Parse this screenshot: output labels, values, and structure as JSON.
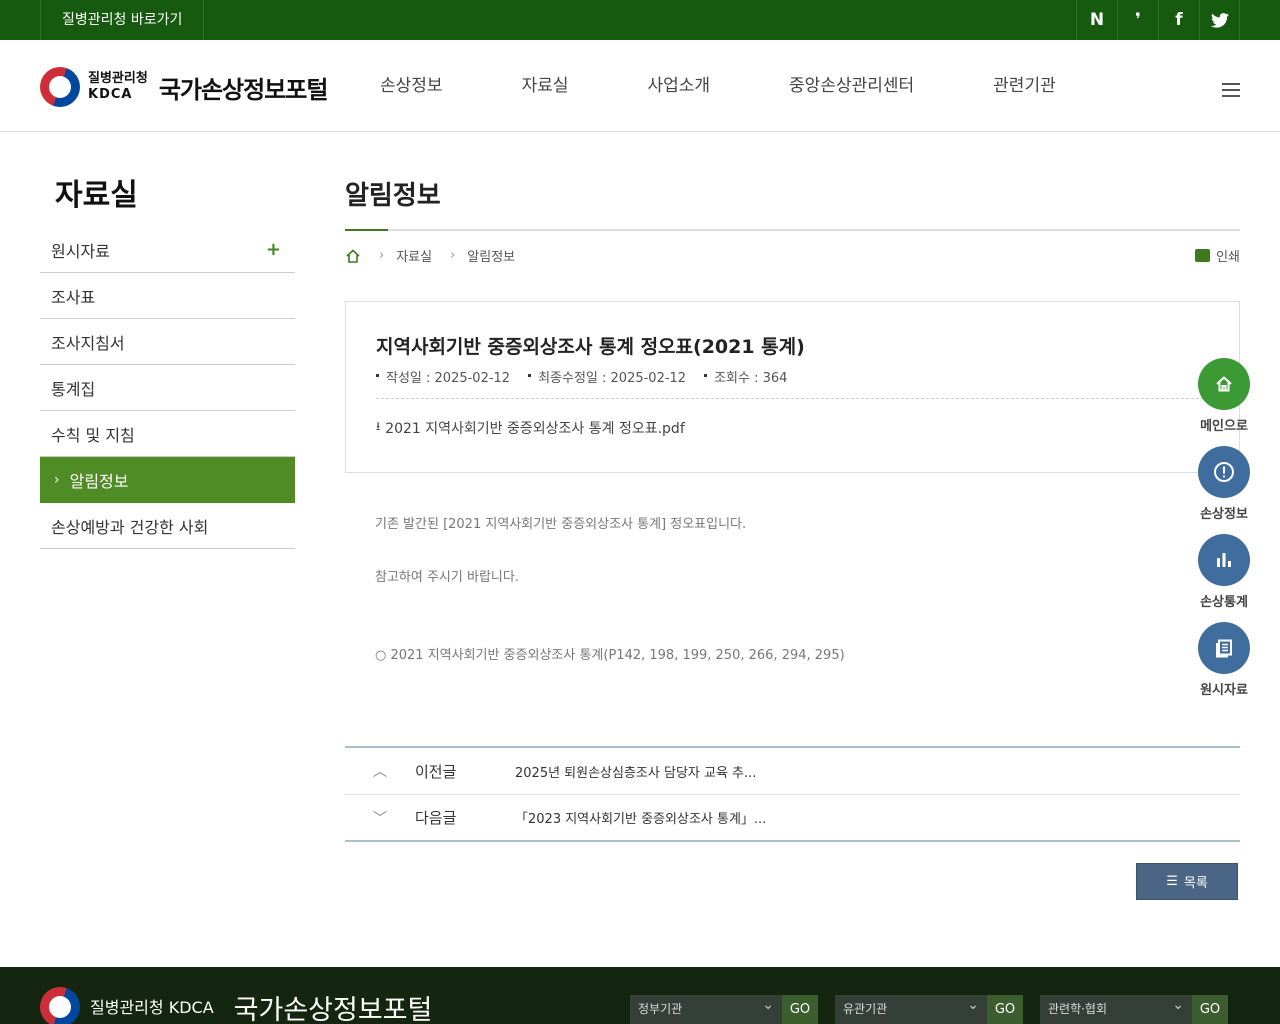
{
  "topbar": {
    "shortcut_label": "질병관리청 바로가기",
    "sns": [
      {
        "icon": "naver-blog-icon",
        "glyph": "N"
      },
      {
        "icon": "kakao-story-icon",
        "glyph": "❜"
      },
      {
        "icon": "facebook-icon",
        "glyph": "f"
      },
      {
        "icon": "twitter-icon",
        "glyph": "🐦"
      }
    ]
  },
  "header": {
    "org_ko": "질병관리청",
    "org_en": "KDCA",
    "portal_name": "국가손상정보포털",
    "nav": [
      "손상정보",
      "자료실",
      "사업소개",
      "중앙손상관리센터",
      "관련기관"
    ]
  },
  "lnb": {
    "title": "자료실",
    "items": [
      {
        "label": "원시자료",
        "expand": "+"
      },
      {
        "label": "조사표"
      },
      {
        "label": "조사지침서"
      },
      {
        "label": "통계집"
      },
      {
        "label": "수칙 및 지침"
      },
      {
        "label": "알림정보",
        "active": true
      },
      {
        "label": "손상예방과 건강한 사회"
      }
    ]
  },
  "content": {
    "page_title": "알림정보",
    "breadcrumb": [
      "자료실",
      "알림정보"
    ],
    "print_label": "인쇄",
    "post": {
      "title": "지역사회기반 중증외상조사 통계 정오표(2021 통계)",
      "meta": [
        "작성일 : 2025-02-12",
        "최종수정일 : 2025-02-12",
        "조회수 : 364"
      ],
      "file_name": "2021 지역사회기반 중증외상조사 통계 정오표.pdf"
    },
    "body": [
      "기존 발간된 [2021 지역사회기반 중증외상조사 통계] 정오표입니다.",
      "참고하여 주시기 바랍니다.",
      "○ 2021 지역사회기반 중증외상조사 통계(P142, 198, 199, 250, 266, 294, 295)"
    ],
    "prev": {
      "label": "이전글",
      "title": "2025년 퇴원손상심층조사 담당자 교육 추..."
    },
    "next": {
      "label": "다음글",
      "title": "「2023 지역사회기반 중증외상조사 통계」..."
    },
    "list_button": "목록"
  },
  "quick": [
    {
      "label": "메인으로",
      "icon": "home-icon",
      "color": "#3c9a34"
    },
    {
      "label": "손상정보",
      "icon": "alert-circle-icon",
      "color": "#3f6d9d"
    },
    {
      "label": "손상통계",
      "icon": "bar-chart-icon",
      "color": "#3f6d9d"
    },
    {
      "label": "원시자료",
      "icon": "document-icon",
      "color": "#3f6d9d"
    }
  ],
  "footer": {
    "org_ko": "질병관리청",
    "org_en": "KDCA",
    "portal_name": "국가손상정보포털",
    "selects": [
      {
        "label": "정부기관",
        "go": "GO"
      },
      {
        "label": "유관기관",
        "go": "GO"
      },
      {
        "label": "관련학·협회",
        "go": "GO"
      }
    ]
  }
}
